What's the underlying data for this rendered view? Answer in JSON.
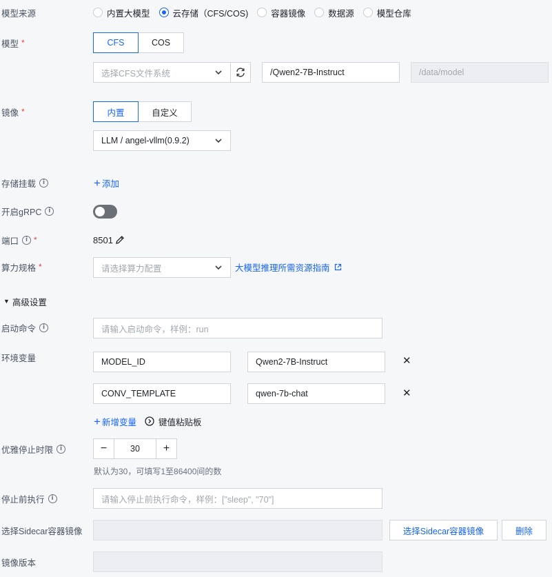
{
  "model_source": {
    "label": "模型来源",
    "options": [
      {
        "label": "内置大模型",
        "selected": false
      },
      {
        "label": "云存储（CFS/COS)",
        "selected": true
      },
      {
        "label": "容器镜像",
        "selected": false
      },
      {
        "label": "数据源",
        "selected": false
      },
      {
        "label": "模型仓库",
        "selected": false
      }
    ]
  },
  "model": {
    "label": "模型",
    "required": "*",
    "tabs": [
      {
        "label": "CFS",
        "selected": true
      },
      {
        "label": "COS",
        "selected": false
      }
    ],
    "cfs_select_placeholder": "选择CFS文件系统",
    "path_value": "/Qwen2-7B-Instruct",
    "mount_path": "/data/model"
  },
  "image": {
    "label": "镜像",
    "required": "*",
    "tabs": [
      {
        "label": "内置",
        "selected": true
      },
      {
        "label": "自定义",
        "selected": false
      }
    ],
    "selected_value": "LLM / angel-vllm(0.9.2)"
  },
  "storage_mount": {
    "label": "存储挂载",
    "add_label": "添加"
  },
  "grpc": {
    "label": "开启gRPC",
    "enabled": false
  },
  "port": {
    "label": "端口",
    "required": "*",
    "value": "8501"
  },
  "compute_spec": {
    "label": "算力规格",
    "required": "*",
    "placeholder": "请选择算力配置",
    "guide_link": "大模型推理所需资源指南"
  },
  "advanced": {
    "label": "高级设置",
    "expanded": true
  },
  "startup_command": {
    "label": "启动命令",
    "placeholder": "请输入启动命令，样例：run"
  },
  "env_vars": {
    "label": "环境变量",
    "rows": [
      {
        "key": "MODEL_ID",
        "value": "Qwen2-7B-Instruct"
      },
      {
        "key": "CONV_TEMPLATE",
        "value": "qwen-7b-chat"
      }
    ],
    "add_label": "新增变量",
    "clipboard_label": "键值粘贴板"
  },
  "graceful_stop": {
    "label": "优雅停止时限",
    "value": "30",
    "minus": "−",
    "plus": "+",
    "hint": "默认为30，可填写1至86400间的数"
  },
  "pre_stop": {
    "label": "停止前执行",
    "placeholder": "请输入停止前执行命令，样例：[\"sleep\", \"70\"]"
  },
  "sidecar": {
    "label": "选择Sidecar容器镜像",
    "select_button": "选择Sidecar容器镜像",
    "delete_button": "删除"
  },
  "image_version": {
    "label": "镜像版本"
  },
  "colors": {
    "primary": "#1664ff",
    "required": "#e54545",
    "background": "#f6f7f9"
  }
}
